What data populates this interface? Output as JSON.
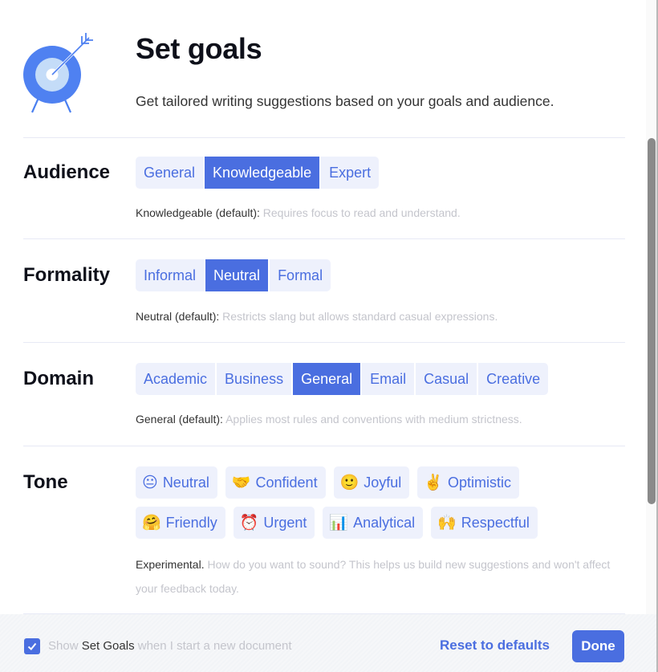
{
  "header": {
    "title": "Set goals",
    "subtitle": "Get tailored writing suggestions based on your goals and audience."
  },
  "colors": {
    "accent": "#4a6ee0",
    "chip_bg": "#eef1fc",
    "muted_text": "#c4c5cc"
  },
  "audience": {
    "label": "Audience",
    "options": [
      "General",
      "Knowledgeable",
      "Expert"
    ],
    "selected": "Knowledgeable",
    "desc_strong": "Knowledgeable (default):",
    "desc_text": " Requires focus to read and understand."
  },
  "formality": {
    "label": "Formality",
    "options": [
      "Informal",
      "Neutral",
      "Formal"
    ],
    "selected": "Neutral",
    "desc_strong": "Neutral (default):",
    "desc_text": " Restricts slang but allows standard casual expressions."
  },
  "domain": {
    "label": "Domain",
    "options": [
      "Academic",
      "Business",
      "General",
      "Email",
      "Casual",
      "Creative"
    ],
    "selected": "General",
    "desc_strong": "General (default):",
    "desc_text": " Applies most rules and conventions with medium strictness."
  },
  "tone": {
    "label": "Tone",
    "options": [
      {
        "emoji": "😐",
        "icon": "neutral-face-icon",
        "label": "Neutral"
      },
      {
        "emoji": "🤝",
        "icon": "handshake-icon",
        "label": "Confident"
      },
      {
        "emoji": "🙂",
        "icon": "smiling-face-icon",
        "label": "Joyful"
      },
      {
        "emoji": "✌️",
        "icon": "victory-hand-icon",
        "label": "Optimistic"
      },
      {
        "emoji": "🤗",
        "icon": "hugging-face-icon",
        "label": "Friendly"
      },
      {
        "emoji": "⏰",
        "icon": "alarm-clock-icon",
        "label": "Urgent"
      },
      {
        "emoji": "📊",
        "icon": "bar-chart-icon",
        "label": "Analytical"
      },
      {
        "emoji": "🙌",
        "icon": "raised-hands-icon",
        "label": "Respectful"
      }
    ],
    "desc_strong": "Experimental.",
    "desc_text": " How do you want to sound? This helps us build new suggestions and won't affect your feedback today."
  },
  "footer": {
    "checkbox_checked": true,
    "show_prefix": "Show ",
    "show_strong": "Set Goals",
    "show_suffix": " when I start a new document",
    "reset_label": "Reset to defaults",
    "done_label": "Done"
  }
}
